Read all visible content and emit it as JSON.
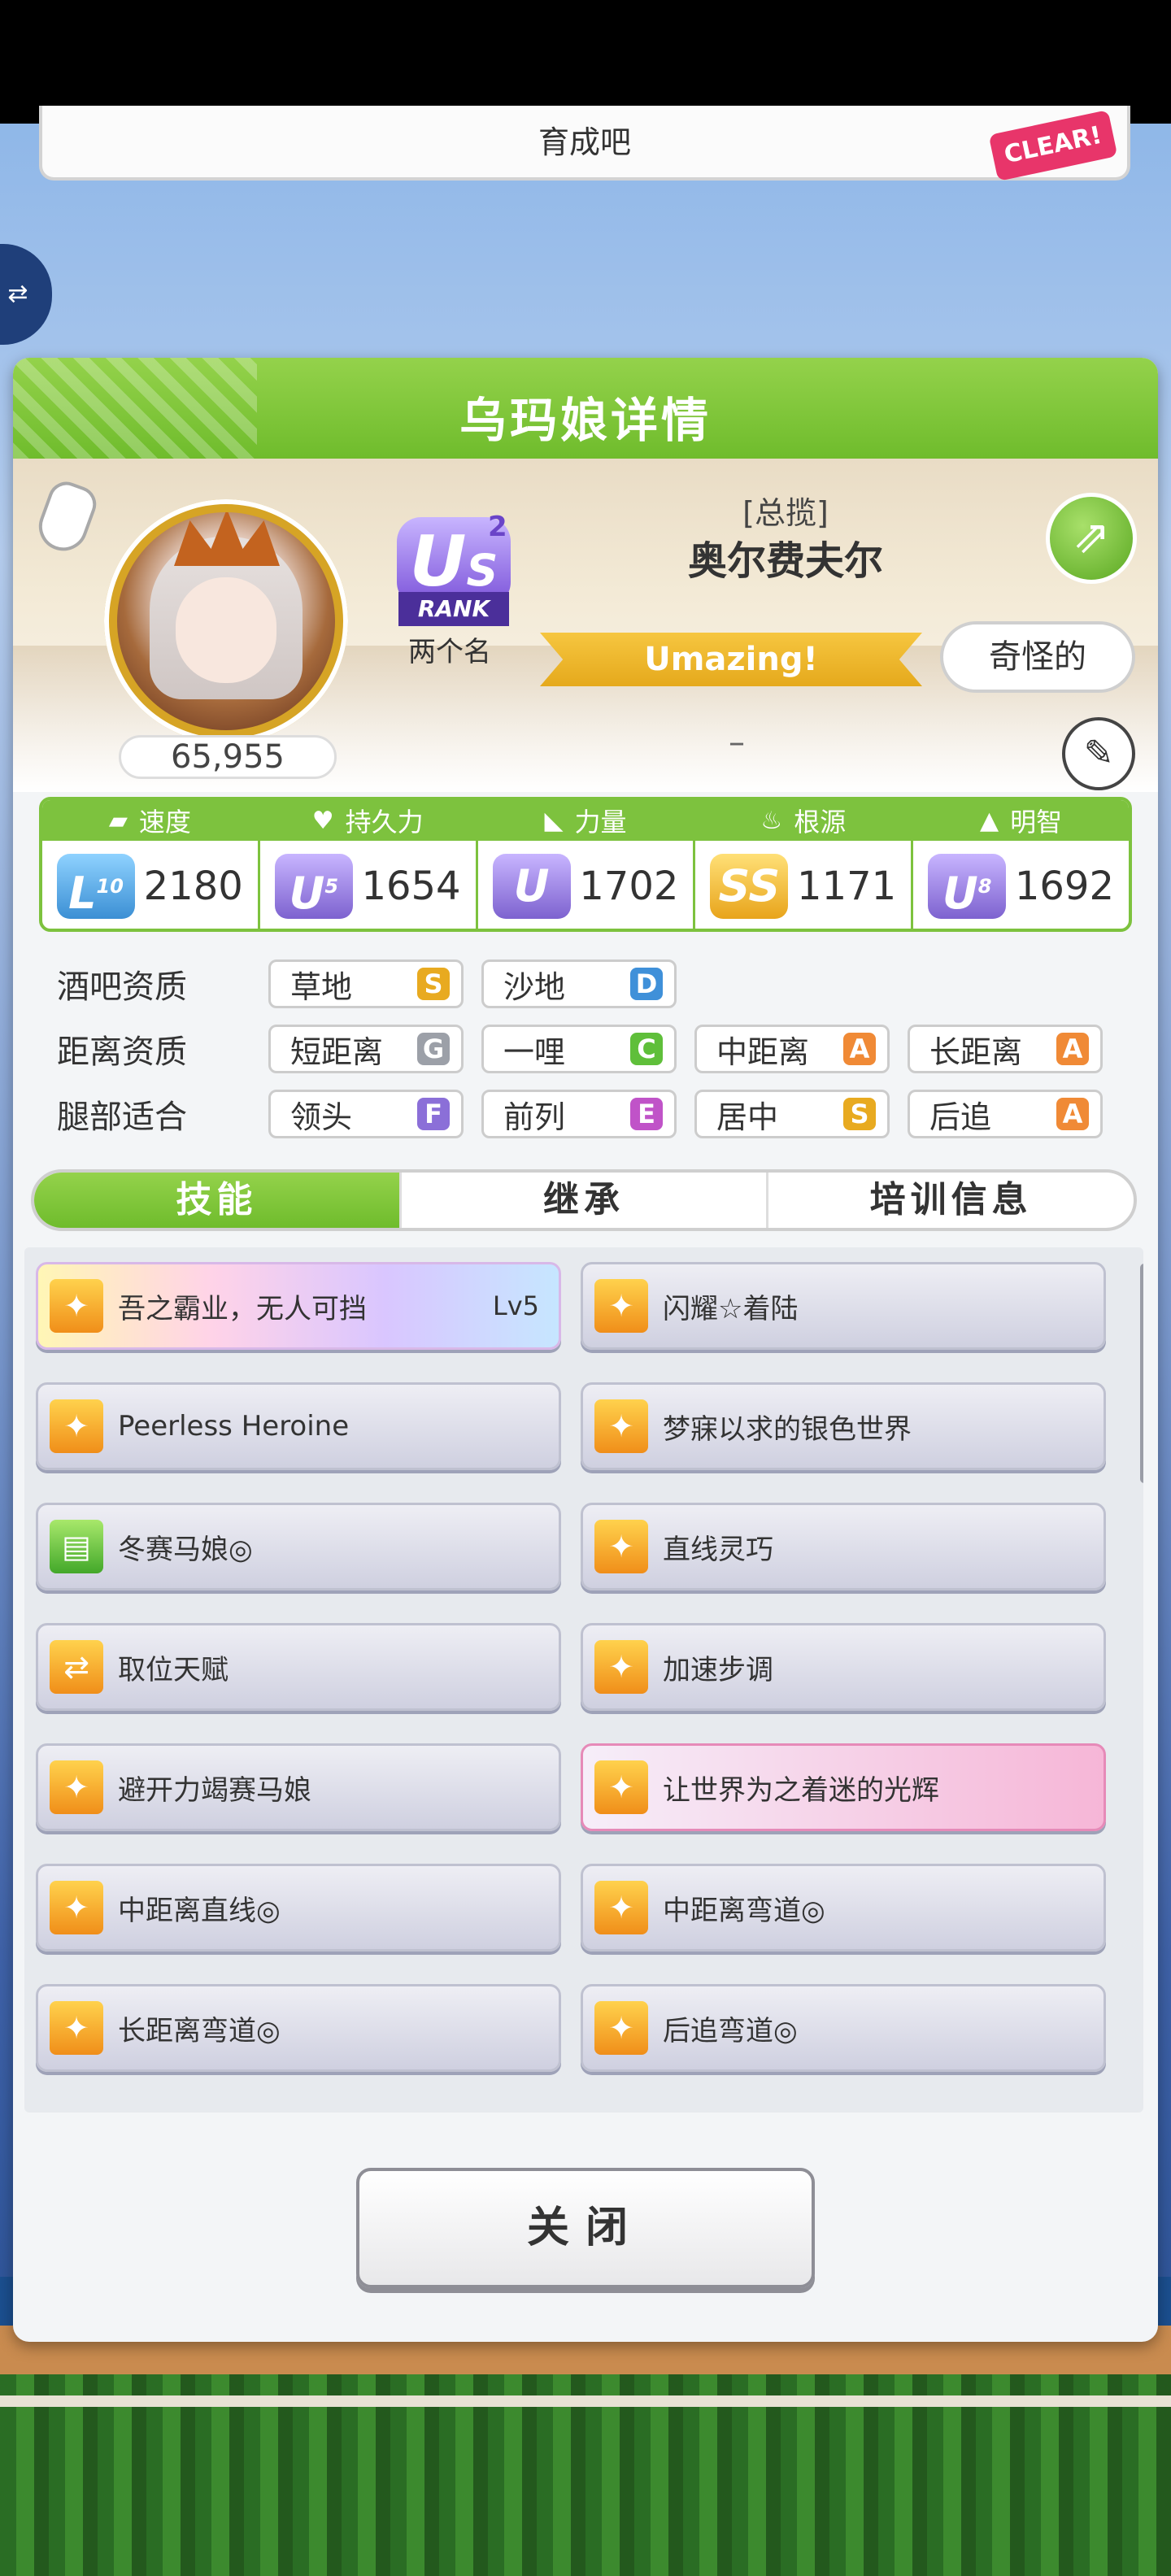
{
  "background": {
    "card_text": "育成吧",
    "stamp": "CLEAR!",
    "translate_icon": "translate-icon"
  },
  "panel": {
    "title": "乌玛娘详情"
  },
  "profile": {
    "fan_count": "65,955",
    "rank": "U",
    "rank_sup": "2",
    "rank_sub": "S",
    "rank_label": "RANK",
    "trainer_name": "两个名",
    "title": "[总揽]",
    "horse_name": "奥尔费夫尔",
    "ribbon": "Umazing!",
    "nickname_button": "奇怪的",
    "dash": "–"
  },
  "stats": [
    {
      "label": "速度",
      "icon": "shoe-icon",
      "rank": "LF",
      "rank_num": "10",
      "value": "2180"
    },
    {
      "label": "持久力",
      "icon": "heart-icon",
      "rank": "UC",
      "rank_num": "5",
      "value": "1654"
    },
    {
      "label": "力量",
      "icon": "arm-icon",
      "rank": "UB",
      "rank_num": "",
      "value": "1702"
    },
    {
      "label": "根源",
      "icon": "flame-icon",
      "rank": "SS+",
      "rank_num": "",
      "value": "1171"
    },
    {
      "label": "明智",
      "icon": "cap-icon",
      "rank": "UC",
      "rank_num": "8",
      "value": "1692"
    }
  ],
  "aptitudes": {
    "track": {
      "label": "酒吧资质",
      "items": [
        {
          "name": "草地",
          "grade": "S"
        },
        {
          "name": "沙地",
          "grade": "D"
        }
      ]
    },
    "distance": {
      "label": "距离资质",
      "items": [
        {
          "name": "短距离",
          "grade": "G"
        },
        {
          "name": "一哩",
          "grade": "C"
        },
        {
          "name": "中距离",
          "grade": "A"
        },
        {
          "name": "长距离",
          "grade": "A"
        }
      ]
    },
    "style": {
      "label": "腿部适合",
      "items": [
        {
          "name": "领头",
          "grade": "F"
        },
        {
          "name": "前列",
          "grade": "E"
        },
        {
          "name": "居中",
          "grade": "S"
        },
        {
          "name": "后追",
          "grade": "A"
        }
      ]
    }
  },
  "tabs": [
    "技能",
    "继承",
    "培训信息"
  ],
  "skills": [
    {
      "label": "吾之霸业，无人可挡",
      "level": "Lv5"
    },
    {
      "label": "闪耀☆着陆"
    },
    {
      "label": "Peerless Heroine"
    },
    {
      "label": "梦寐以求的银色世界"
    },
    {
      "label": "冬赛马娘◎"
    },
    {
      "label": "直线灵巧"
    },
    {
      "label": "取位天赋"
    },
    {
      "label": "加速步调"
    },
    {
      "label": "避开力竭赛马娘"
    },
    {
      "label": "让世界为之着迷的光辉"
    },
    {
      "label": "中距离直线◎"
    },
    {
      "label": "中距离弯道◎"
    },
    {
      "label": "长距离弯道◎"
    },
    {
      "label": "后追弯道◎"
    }
  ],
  "close_label": "关闭"
}
